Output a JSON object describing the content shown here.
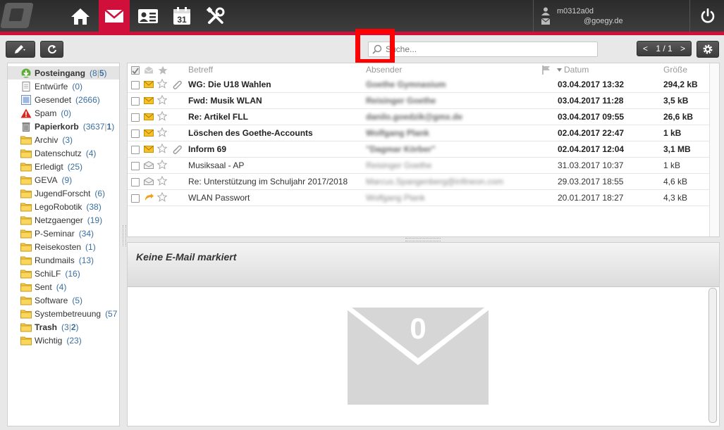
{
  "user": {
    "account_id": "m0312a0d",
    "email_domain": "@goegy.de"
  },
  "search": {
    "placeholder": "Suche..."
  },
  "pager": {
    "prev": "<",
    "label": "1 / 1",
    "next": ">"
  },
  "folders": [
    {
      "name": "Posteingang",
      "count": "8",
      "unread": "5",
      "bold": true,
      "icon": "inbox-icon"
    },
    {
      "name": "Entwürfe",
      "count": "(0)",
      "icon": "drafts-icon"
    },
    {
      "name": "Gesendet",
      "count": "(2666)",
      "icon": "sent-icon"
    },
    {
      "name": "Spam",
      "count": "(0)",
      "icon": "spam-warning-icon"
    },
    {
      "name": "Papierkorb",
      "count": "3637",
      "unread": "1",
      "bold": true,
      "icon": "trash-icon"
    },
    {
      "name": "Archiv",
      "count": "(3)",
      "icon": "folder-icon"
    },
    {
      "name": "Datenschutz",
      "count": "(4)",
      "icon": "folder-icon"
    },
    {
      "name": "Erledigt",
      "count": "(25)",
      "icon": "folder-icon"
    },
    {
      "name": "GEVA",
      "count": "(9)",
      "icon": "folder-icon"
    },
    {
      "name": "JugendForscht",
      "count": "(6)",
      "icon": "folder-icon"
    },
    {
      "name": "LegoRobotik",
      "count": "(38)",
      "icon": "folder-icon"
    },
    {
      "name": "Netzgaenger",
      "count": "(19)",
      "icon": "folder-icon"
    },
    {
      "name": "P-Seminar",
      "count": "(34)",
      "icon": "folder-icon"
    },
    {
      "name": "Reisekosten",
      "count": "(1)",
      "icon": "folder-icon"
    },
    {
      "name": "Rundmails",
      "count": "(13)",
      "icon": "folder-icon"
    },
    {
      "name": "SchiLF",
      "count": "(16)",
      "icon": "folder-icon"
    },
    {
      "name": "Sent",
      "count": "(4)",
      "icon": "folder-icon"
    },
    {
      "name": "Software",
      "count": "(5)",
      "icon": "folder-icon"
    },
    {
      "name": "Systembetreuung",
      "count": "(57",
      "icon": "folder-icon"
    },
    {
      "name": "Trash",
      "count": "3",
      "unread": "2",
      "bold": true,
      "icon": "folder-icon"
    },
    {
      "name": "Wichtig",
      "count": "(23)",
      "icon": "folder-icon"
    }
  ],
  "list_headers": {
    "subject": "Betreff",
    "sender": "Absender",
    "date": "Datum",
    "size": "Größe"
  },
  "messages": [
    {
      "subject": "WG: Die U18 Wahlen",
      "sender": "Goethe Gymnasium",
      "date": "03.04.2017 13:32",
      "size": "294,2 kB",
      "unread": true,
      "attachment": true,
      "status": "unread"
    },
    {
      "subject": "Fwd: Musik WLAN",
      "sender": "Reisinger Goethe",
      "date": "03.04.2017 11:28",
      "size": "3,5 kB",
      "unread": true,
      "attachment": false,
      "status": "unread"
    },
    {
      "subject": "Re: Artikel FLL",
      "sender": "danilo.goedzik@gmx.de",
      "date": "03.04.2017 09:55",
      "size": "26,6 kB",
      "unread": true,
      "attachment": false,
      "status": "unread"
    },
    {
      "subject": "Löschen des Goethe-Accounts",
      "sender": "Wolfgang Plank",
      "date": "02.04.2017 22:47",
      "size": "1 kB",
      "unread": true,
      "attachment": false,
      "status": "unread"
    },
    {
      "subject": "Inform 69",
      "sender": "\"Dagmar Körber\"",
      "date": "02.04.2017 12:04",
      "size": "3,1 MB",
      "unread": true,
      "attachment": true,
      "status": "unread"
    },
    {
      "subject": "Musiksaal - AP",
      "sender": "Reisinger Goethe",
      "date": "31.03.2017 10:37",
      "size": "1 kB",
      "unread": false,
      "attachment": false,
      "status": "read"
    },
    {
      "subject": "Re: Unterstützung im Schuljahr 2017/2018",
      "sender": "Marcus.Spangenberg@infineon.com",
      "date": "29.03.2017 18:55",
      "size": "4,6 kB",
      "unread": false,
      "attachment": false,
      "status": "read"
    },
    {
      "subject": "WLAN Passwort",
      "sender": "Wolfgang Plank",
      "date": "20.01.2017 18:27",
      "size": "4,3 kB",
      "unread": false,
      "attachment": false,
      "status": "replied"
    }
  ],
  "preview": {
    "title": "Keine E-Mail markiert",
    "count": "0"
  },
  "colors": {
    "accent": "#d0103a",
    "unread_icon": "#f5c02a",
    "count_blue": "#3a6fa0"
  }
}
